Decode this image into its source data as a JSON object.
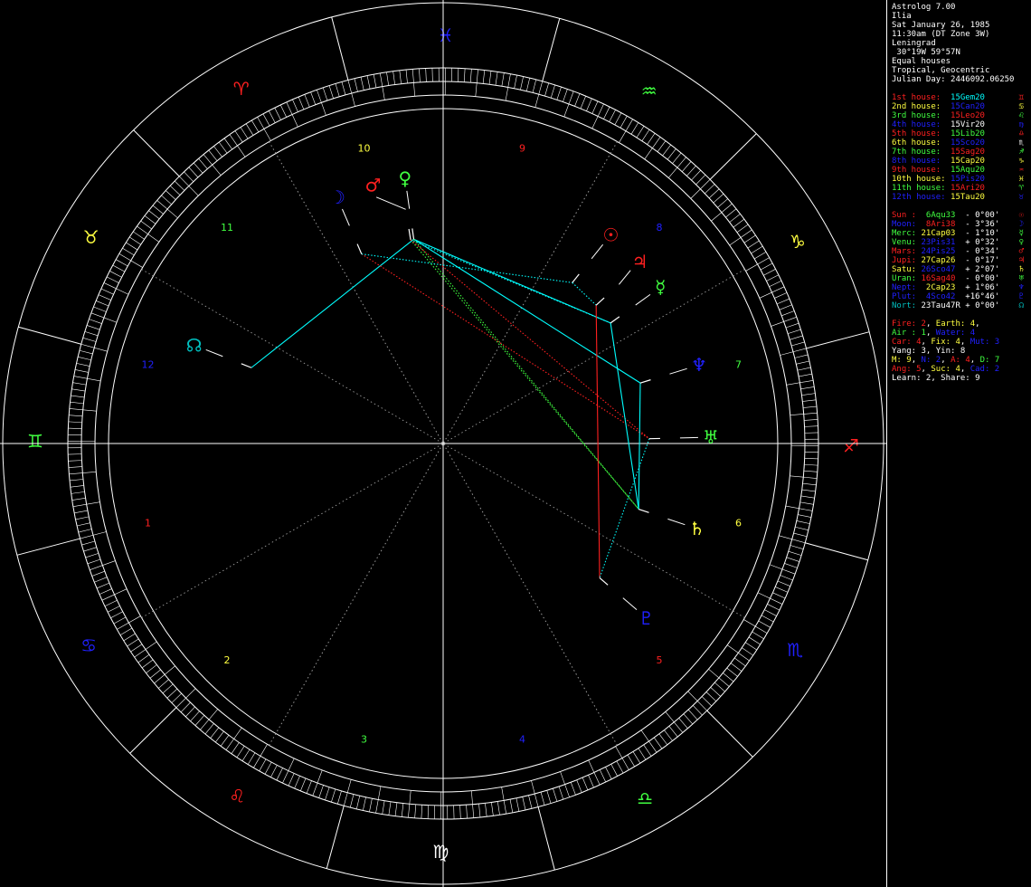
{
  "header": {
    "app_title": "Astrolog 7.00",
    "name": "Ilia",
    "date": "Sat January 26, 1985",
    "time": "11:30am (DT Zone 3W)",
    "place": "Leningrad",
    "coords": " 30°19W 59°57N",
    "house_system": "Equal houses",
    "zodiac": "Tropical, Geocentric",
    "julian_day": "Julian Day: 2446092.06250"
  },
  "houses": [
    {
      "label": "1st house:",
      "pos": "15Gem20",
      "label_color": "#ff2020",
      "pos_color": "#00ffff",
      "glyph": "♊",
      "glyph_color": "#ff2020"
    },
    {
      "label": "2nd house:",
      "pos": "15Can20",
      "label_color": "#ffff40",
      "pos_color": "#2020ff",
      "glyph": "♋",
      "glyph_color": "#ffff40"
    },
    {
      "label": "3rd house:",
      "pos": "15Leo20",
      "label_color": "#40ff40",
      "pos_color": "#ff2020",
      "glyph": "♌",
      "glyph_color": "#40ff40"
    },
    {
      "label": "4th house:",
      "pos": "15Vir20",
      "label_color": "#2020ff",
      "pos_color": "#ffffff",
      "glyph": "♍",
      "glyph_color": "#2020ff"
    },
    {
      "label": "5th house:",
      "pos": "15Lib20",
      "label_color": "#ff2020",
      "pos_color": "#40ff40",
      "glyph": "♎",
      "glyph_color": "#ff2020"
    },
    {
      "label": "6th house:",
      "pos": "15Sco20",
      "label_color": "#ffff40",
      "pos_color": "#2020ff",
      "glyph": "♏",
      "glyph_color": "#ffffff"
    },
    {
      "label": "7th house:",
      "pos": "15Sag20",
      "label_color": "#40ff40",
      "pos_color": "#ff2020",
      "glyph": "♐",
      "glyph_color": "#40ff40"
    },
    {
      "label": "8th house:",
      "pos": "15Cap20",
      "label_color": "#2020ff",
      "pos_color": "#ffff40",
      "glyph": "♑",
      "glyph_color": "#ffff40"
    },
    {
      "label": "9th house:",
      "pos": "15Aqu20",
      "label_color": "#ff2020",
      "pos_color": "#40ff40",
      "glyph": "♒",
      "glyph_color": "#ff2020"
    },
    {
      "label": "10th house:",
      "pos": "15Pis20",
      "label_color": "#ffff40",
      "pos_color": "#2020ff",
      "glyph": "♓",
      "glyph_color": "#ffff40"
    },
    {
      "label": "11th house:",
      "pos": "15Ari20",
      "label_color": "#40ff40",
      "pos_color": "#ff2020",
      "glyph": "♈",
      "glyph_color": "#40ff40"
    },
    {
      "label": "12th house:",
      "pos": "15Tau20",
      "label_color": "#2020ff",
      "pos_color": "#ffff40",
      "glyph": "♉",
      "glyph_color": "#2020ff"
    }
  ],
  "planets": [
    {
      "label": "Sun :",
      "pos": " 6Aqu33",
      "dec": " - 0°00'",
      "label_color": "#ff2020",
      "pos_color": "#40ff40",
      "glyph": "☉",
      "glyph_color": "#ff2020"
    },
    {
      "label": "Moon:",
      "pos": " 8Ari38",
      "dec": " - 3°36'",
      "label_color": "#2020ff",
      "pos_color": "#ff2020",
      "glyph": "☽",
      "glyph_color": "#2020ff"
    },
    {
      "label": "Merc:",
      "pos": "21Cap03",
      "dec": " - 1°10'",
      "label_color": "#40ff40",
      "pos_color": "#ffff40",
      "glyph": "☿",
      "glyph_color": "#40ff40"
    },
    {
      "label": "Venu:",
      "pos": "23Pis31",
      "dec": " + 0°32'",
      "label_color": "#40ff40",
      "pos_color": "#2020ff",
      "glyph": "♀",
      "glyph_color": "#40ff40"
    },
    {
      "label": "Mars:",
      "pos": "24Pis25",
      "dec": " - 0°34'",
      "label_color": "#ff2020",
      "pos_color": "#2020ff",
      "glyph": "♂",
      "glyph_color": "#ff2020"
    },
    {
      "label": "Jupi:",
      "pos": "27Cap26",
      "dec": " - 0°17'",
      "label_color": "#ff2020",
      "pos_color": "#ffff40",
      "glyph": "♃",
      "glyph_color": "#ff2020"
    },
    {
      "label": "Satu:",
      "pos": "26Sco47",
      "dec": " + 2°07'",
      "label_color": "#ffff40",
      "pos_color": "#2020ff",
      "glyph": "♄",
      "glyph_color": "#ffff40"
    },
    {
      "label": "Uran:",
      "pos": "16Sag40",
      "dec": " - 0°00'",
      "label_color": "#40ff40",
      "pos_color": "#ff2020",
      "glyph": "♅",
      "glyph_color": "#40ff40"
    },
    {
      "label": "Nept:",
      "pos": " 2Cap23",
      "dec": " + 1°06'",
      "label_color": "#2020ff",
      "pos_color": "#ffff40",
      "glyph": "♆",
      "glyph_color": "#2020ff"
    },
    {
      "label": "Plut:",
      "pos": " 4Sco42",
      "dec": " +16°46'",
      "label_color": "#2020ff",
      "pos_color": "#2020ff",
      "glyph": "♇",
      "glyph_color": "#2020ff"
    },
    {
      "label": "Nort:",
      "pos": "23Tau47R",
      "dec": " + 0°00'",
      "label_color": "#00c0c0",
      "pos_color": "#ffffff",
      "glyph": "☊",
      "glyph_color": "#00c0c0"
    }
  ],
  "summary": [
    [
      {
        "t": "Fire: 2",
        "c": "#ff2020"
      },
      {
        "t": ", ",
        "c": "#ffffff"
      },
      {
        "t": "Earth: 4",
        "c": "#ffff40"
      },
      {
        "t": ",",
        "c": "#ffffff"
      }
    ],
    [
      {
        "t": "Air : 1",
        "c": "#40ff40"
      },
      {
        "t": ", ",
        "c": "#ffffff"
      },
      {
        "t": "Water: 4",
        "c": "#2020ff"
      }
    ],
    [
      {
        "t": "Car: 4",
        "c": "#ff2020"
      },
      {
        "t": ", ",
        "c": "#ffffff"
      },
      {
        "t": "Fix: 4",
        "c": "#ffff40"
      },
      {
        "t": ", ",
        "c": "#ffffff"
      },
      {
        "t": "Mut: 3",
        "c": "#2020ff"
      }
    ],
    [
      {
        "t": "Yang: 3, Yin: 8",
        "c": "#ffffff"
      }
    ],
    [
      {
        "t": "M: 9",
        "c": "#ffff40"
      },
      {
        "t": ", ",
        "c": "#ffffff"
      },
      {
        "t": "N: 2",
        "c": "#2020ff"
      },
      {
        "t": ", ",
        "c": "#ffffff"
      },
      {
        "t": "A: 4",
        "c": "#ff2020"
      },
      {
        "t": ", ",
        "c": "#ffffff"
      },
      {
        "t": "D: 7",
        "c": "#40ff40"
      }
    ],
    [
      {
        "t": "Ang: 5",
        "c": "#ff2020"
      },
      {
        "t": ", ",
        "c": "#ffffff"
      },
      {
        "t": "Suc: 4",
        "c": "#ffff40"
      },
      {
        "t": ", ",
        "c": "#ffffff"
      },
      {
        "t": "Cad: 2",
        "c": "#2020ff"
      }
    ],
    [
      {
        "t": "Learn: 2, Share: 9",
        "c": "#ffffff"
      }
    ]
  ],
  "wheel": {
    "signs": [
      {
        "name": "aries",
        "glyph": "♈",
        "color": "#ff2020"
      },
      {
        "name": "taurus",
        "glyph": "♉",
        "color": "#ffff40"
      },
      {
        "name": "gemini",
        "glyph": "♊",
        "color": "#40ff40"
      },
      {
        "name": "cancer",
        "glyph": "♋",
        "color": "#2020ff"
      },
      {
        "name": "leo",
        "glyph": "♌",
        "color": "#ff2020"
      },
      {
        "name": "virgo",
        "glyph": "♍",
        "color": "#ffffff"
      },
      {
        "name": "libra",
        "glyph": "♎",
        "color": "#40ff40"
      },
      {
        "name": "scorpio",
        "glyph": "♏",
        "color": "#2020ff"
      },
      {
        "name": "sagittarius",
        "glyph": "♐",
        "color": "#ff2020"
      },
      {
        "name": "capricorn",
        "glyph": "♑",
        "color": "#ffff40"
      },
      {
        "name": "aquarius",
        "glyph": "♒",
        "color": "#40ff40"
      },
      {
        "name": "pisces",
        "glyph": "♓",
        "color": "#2020ff"
      }
    ],
    "house_numbers": [
      {
        "n": "1",
        "color": "#ff2020"
      },
      {
        "n": "2",
        "color": "#ffff40"
      },
      {
        "n": "3",
        "color": "#40ff40"
      },
      {
        "n": "4",
        "color": "#2020ff"
      },
      {
        "n": "5",
        "color": "#ff2020"
      },
      {
        "n": "6",
        "color": "#ffff40"
      },
      {
        "n": "7",
        "color": "#40ff40"
      },
      {
        "n": "8",
        "color": "#2020ff"
      },
      {
        "n": "9",
        "color": "#ff2020"
      },
      {
        "n": "10",
        "color": "#ffff40"
      },
      {
        "n": "11",
        "color": "#40ff40"
      },
      {
        "n": "12",
        "color": "#2020ff"
      }
    ],
    "ascendant_longitude": 75.333,
    "planet_longitudes": {
      "sun": 306.55,
      "moon": 8.633,
      "mercury": 291.05,
      "venus": 353.517,
      "mars": 354.417,
      "jupiter": 297.433,
      "saturn": 236.783,
      "uranus": 256.667,
      "neptune": 272.383,
      "pluto": 214.7,
      "node": 53.783
    },
    "planet_glyphs": [
      {
        "key": "sun",
        "glyph": "☉",
        "color": "#ff2020"
      },
      {
        "key": "moon",
        "glyph": "☽",
        "color": "#2020ff"
      },
      {
        "key": "mercury",
        "glyph": "☿",
        "color": "#40ff40"
      },
      {
        "key": "venus",
        "glyph": "♀",
        "color": "#40ff40"
      },
      {
        "key": "mars",
        "glyph": "♂",
        "color": "#ff2020"
      },
      {
        "key": "jupiter",
        "glyph": "♃",
        "color": "#ff2020"
      },
      {
        "key": "saturn",
        "glyph": "♄",
        "color": "#ffff40"
      },
      {
        "key": "uranus",
        "glyph": "♅",
        "color": "#40ff40"
      },
      {
        "key": "neptune",
        "glyph": "♆",
        "color": "#2020ff"
      },
      {
        "key": "pluto",
        "glyph": "♇",
        "color": "#2020ff"
      },
      {
        "key": "node",
        "glyph": "☊",
        "color": "#00c0c0"
      }
    ],
    "aspects": [
      {
        "a": "venus",
        "b": "neptune",
        "color": "#00ffff",
        "style": "solid"
      },
      {
        "a": "venus",
        "b": "mercury",
        "color": "#00ffff",
        "style": "solid"
      },
      {
        "a": "venus",
        "b": "node",
        "color": "#00ffff",
        "style": "solid"
      },
      {
        "a": "mars",
        "b": "mercury",
        "color": "#00ffff",
        "style": "dotted"
      },
      {
        "a": "venus",
        "b": "saturn",
        "color": "#40ff40",
        "style": "dotted"
      },
      {
        "a": "mars",
        "b": "saturn",
        "color": "#40ff40",
        "style": "dotted"
      },
      {
        "a": "mars",
        "b": "uranus",
        "color": "#ff2020",
        "style": "dotted"
      },
      {
        "a": "moon",
        "b": "uranus",
        "color": "#ff2020",
        "style": "dotted"
      },
      {
        "a": "moon",
        "b": "sun",
        "color": "#00ffff",
        "style": "dotted"
      },
      {
        "a": "mercury",
        "b": "saturn",
        "color": "#00ffff",
        "style": "solid"
      },
      {
        "a": "jupiter",
        "b": "pluto",
        "color": "#ff2020",
        "style": "solid"
      },
      {
        "a": "sun",
        "b": "jupiter",
        "color": "#00ffff",
        "style": "dotted"
      },
      {
        "a": "uranus",
        "b": "pluto",
        "color": "#00ffff",
        "style": "dotted"
      },
      {
        "a": "neptune",
        "b": "saturn",
        "color": "#00ffff",
        "style": "solid"
      }
    ]
  }
}
